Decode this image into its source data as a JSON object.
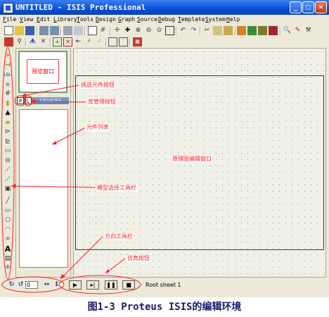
{
  "window": {
    "title": "UNTITLED - ISIS Professional",
    "minimize_glyph": "_",
    "maximize_glyph": "□",
    "close_glyph": "×"
  },
  "menu": [
    "File",
    "View",
    "Edit",
    "Library",
    "Tools",
    "Design",
    "Graph",
    "Source",
    "Debug",
    "Template",
    "System",
    "Help"
  ],
  "preview": {
    "label": "预览窗口"
  },
  "device_panel": {
    "p_button": "P",
    "l_button": "L",
    "header": "DEVICES"
  },
  "annotations": {
    "pick_device": "挑选元件按钮",
    "library_manager": "库管理按钮",
    "device_list": "元件列表",
    "editor_window": "原理图编辑窗口",
    "mode_toolbar": "模型选择工具栏",
    "orientation_toolbar": "方向工具栏",
    "simulation_buttons": "仿真按钮"
  },
  "status": {
    "rotation_value": "0",
    "sheet_label": "Root sheet 1"
  },
  "caption": "图1-3  Proteus ISIS的编辑环境",
  "colors": {
    "titlebar": "#0a4fd6",
    "annotation": "#ff2020",
    "sheet_border": "#2a2aa8"
  }
}
